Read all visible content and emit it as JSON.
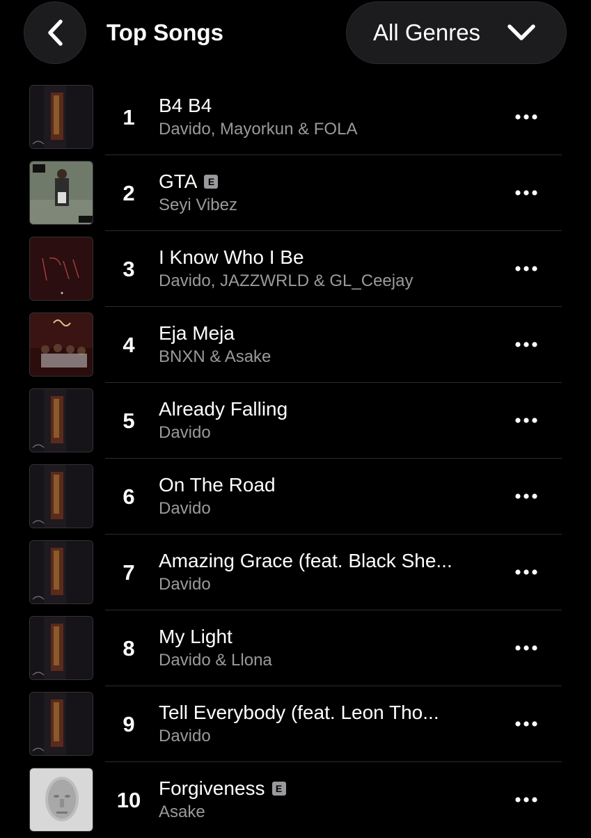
{
  "header": {
    "title": "Top Songs",
    "genre_filter": "All Genres",
    "back_icon": "chevron-left-icon",
    "genre_icon": "chevron-down-icon"
  },
  "songs": [
    {
      "rank": "1",
      "title": "B4 B4",
      "artist": "Davido, Mayorkun & FOLA",
      "explicit": false,
      "artwork": "album-cover-dark"
    },
    {
      "rank": "2",
      "title": "GTA",
      "artist": "Seyi Vibez",
      "explicit": true,
      "artwork": "album-cover-game"
    },
    {
      "rank": "3",
      "title": "I Know Who I Be",
      "artist": "Davido, JAZZWRLD & GL_Ceejay",
      "explicit": false,
      "artwork": "album-cover-red-text"
    },
    {
      "rank": "4",
      "title": "Eja Meja",
      "artist": "BNXN & Asake",
      "explicit": false,
      "artwork": "album-cover-group"
    },
    {
      "rank": "5",
      "title": "Already Falling",
      "artist": "Davido",
      "explicit": false,
      "artwork": "album-cover-dark"
    },
    {
      "rank": "6",
      "title": "On The Road",
      "artist": "Davido",
      "explicit": false,
      "artwork": "album-cover-dark"
    },
    {
      "rank": "7",
      "title": "Amazing Grace (feat. Black She...",
      "artist": "Davido",
      "explicit": false,
      "artwork": "album-cover-dark"
    },
    {
      "rank": "8",
      "title": "My Light",
      "artist": "Davido & Llona",
      "explicit": false,
      "artwork": "album-cover-dark"
    },
    {
      "rank": "9",
      "title": "Tell Everybody (feat. Leon Tho...",
      "artist": "Davido",
      "explicit": false,
      "artwork": "album-cover-dark"
    },
    {
      "rank": "10",
      "title": "Forgiveness",
      "artist": "Asake",
      "explicit": true,
      "artwork": "album-cover-face"
    }
  ],
  "explicit_label": "E",
  "more_icon": "more-ellipsis-icon",
  "colors": {
    "background": "#000000",
    "surface": "#1c1c1e",
    "text_primary": "#ffffff",
    "text_secondary": "#9a9a9e",
    "divider": "#2c2c2e"
  }
}
